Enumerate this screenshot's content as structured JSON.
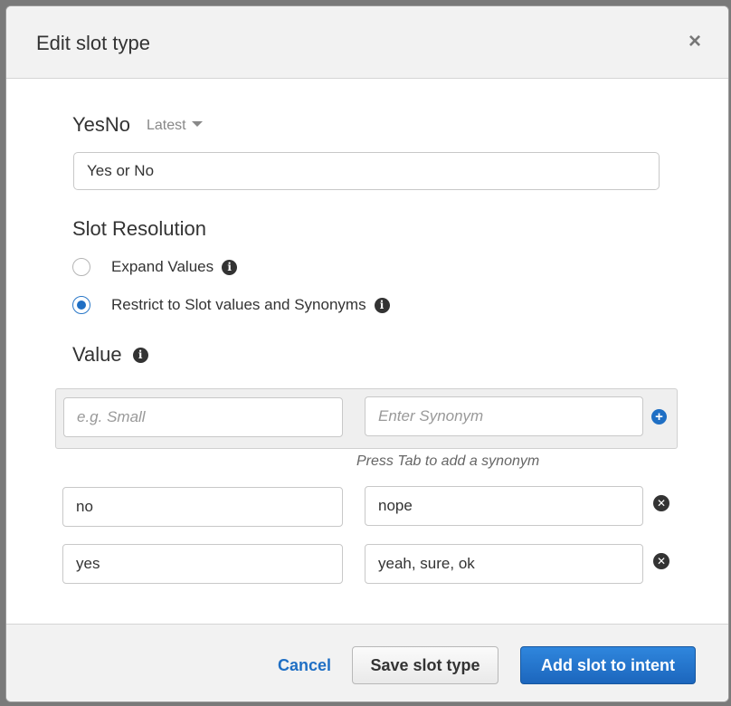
{
  "dialog": {
    "title": "Edit slot type",
    "close_symbol": "×"
  },
  "slot_type": {
    "name": "YesNo",
    "version": "Latest",
    "description": "Yes or No"
  },
  "slot_resolution": {
    "title": "Slot Resolution",
    "options": [
      {
        "label": "Expand Values",
        "selected": false
      },
      {
        "label": "Restrict to Slot values and Synonyms",
        "selected": true
      }
    ]
  },
  "values": {
    "title": "Value",
    "new_value_placeholder": "e.g. Small",
    "new_synonym_placeholder": "Enter Synonym",
    "hint": "Press Tab to add a synonym",
    "rows": [
      {
        "value": "no",
        "synonyms": "nope"
      },
      {
        "value": "yes",
        "synonyms": "yeah, sure, ok"
      }
    ]
  },
  "footer": {
    "cancel_label": "Cancel",
    "save_label": "Save slot type",
    "add_label": "Add slot to intent"
  },
  "icons": {
    "info": "info-icon",
    "add": "plus-circle-icon",
    "remove": "remove-circle-icon",
    "dropdown": "caret-down-icon"
  },
  "colors": {
    "primary": "#1f6fc4",
    "header_bg": "#f2f2f2"
  }
}
